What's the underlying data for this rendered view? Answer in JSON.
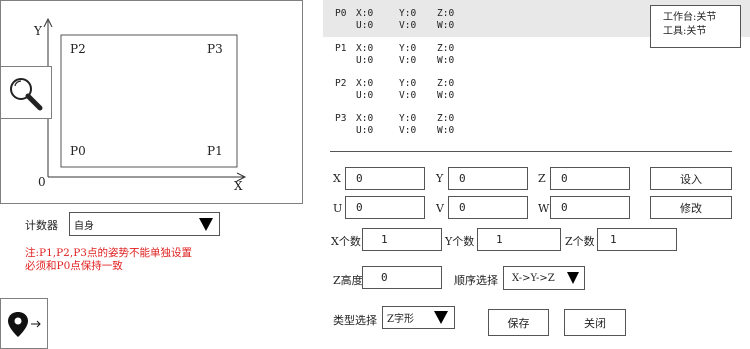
{
  "canvas": {
    "axis_y": "Y",
    "axis_x": "X",
    "origin": "0",
    "points": {
      "p0": "P0",
      "p1": "P1",
      "p2": "P2",
      "p3": "P3"
    }
  },
  "icons": {
    "zoom": "magnifier-icon",
    "nav": "location-pin-arrow-icon"
  },
  "counter": {
    "label": "计数器",
    "value": "自身"
  },
  "note": {
    "line1": "注:P1,P2,P3点的姿势不能单独设置",
    "line2": "必须和P0点保持一致",
    "color": "#e02020"
  },
  "poses": [
    {
      "id": "P0",
      "x": "X:0",
      "y": "Y:0",
      "z": "Z:0",
      "u": "U:0",
      "v": "V:0",
      "w": "W:0"
    },
    {
      "id": "P1",
      "x": "X:0",
      "y": "Y:0",
      "z": "Z:0",
      "u": "U:0",
      "v": "V:0",
      "w": "W:0"
    },
    {
      "id": "P2",
      "x": "X:0",
      "y": "Y:0",
      "z": "Z:0",
      "u": "U:0",
      "v": "V:0",
      "w": "W:0"
    },
    {
      "id": "P3",
      "x": "X:0",
      "y": "Y:0",
      "z": "Z:0",
      "u": "U:0",
      "v": "V:0",
      "w": "W:0"
    }
  ],
  "status": {
    "workbench": "工作台:关节",
    "tool": "工具:关节"
  },
  "fields": {
    "x_label": "X",
    "x_value": "0",
    "y_label": "Y",
    "y_value": "0",
    "z_label": "Z",
    "z_value": "0",
    "u_label": "U",
    "u_value": "0",
    "v_label": "V",
    "v_value": "0",
    "w_label": "W",
    "w_value": "0"
  },
  "buttons": {
    "set_in": "设入",
    "modify": "修改",
    "save": "保存",
    "close": "关闭"
  },
  "counts": {
    "x_label": "X个数",
    "x_value": "1",
    "y_label": "Y个数",
    "y_value": "1",
    "z_label": "Z个数",
    "z_value": "1"
  },
  "z_height": {
    "label": "Z高度",
    "value": "0"
  },
  "order": {
    "label": "顺序选择",
    "value": "X->Y->Z"
  },
  "type": {
    "label": "类型选择",
    "value": "Z字形"
  }
}
